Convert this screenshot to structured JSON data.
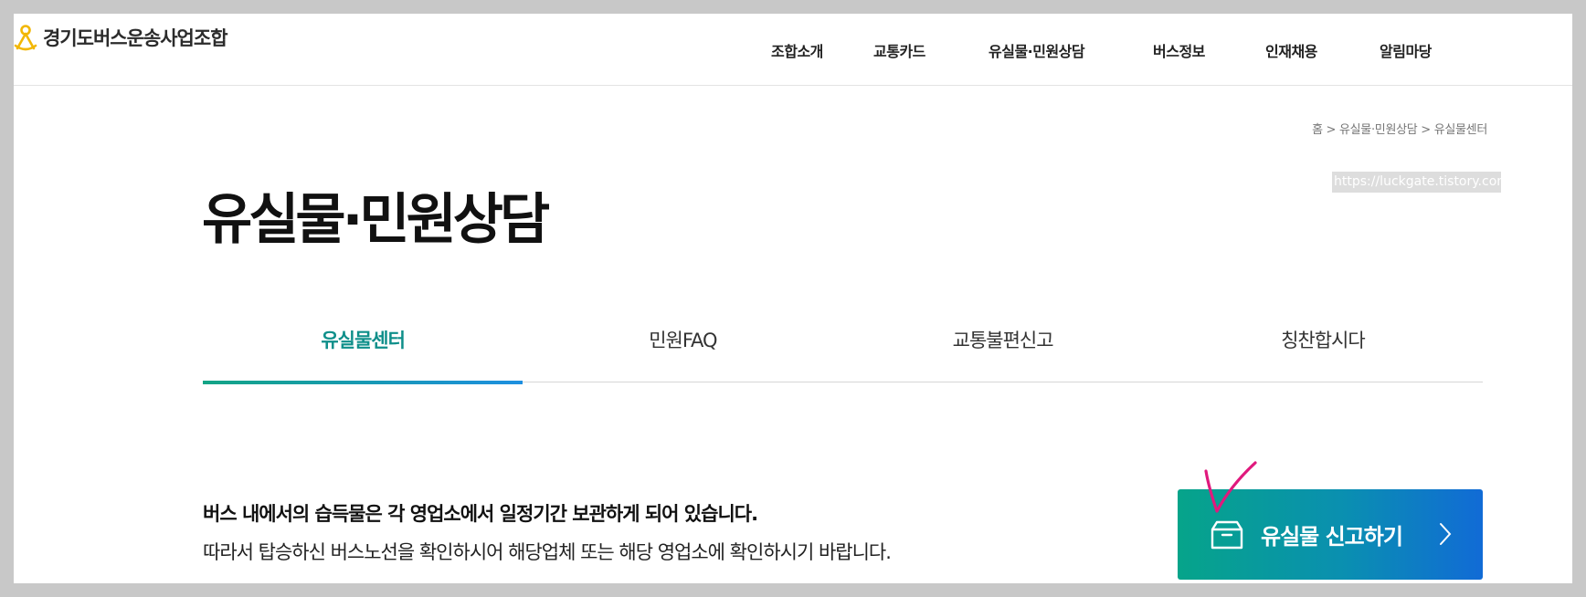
{
  "site": {
    "logo_text": "경기도버스운송사업조합"
  },
  "nav": {
    "items": [
      "조합소개",
      "교통카드",
      "유실물·민원상담",
      "버스정보",
      "인재채용",
      "알림마당"
    ]
  },
  "breadcrumb": "홈 > 유실물·민원상담 > 유실물센터",
  "watermark": "https://luckgate.tistory.com",
  "page_title": "유실물·민원상담",
  "tabs": [
    {
      "label": "유실물센터",
      "active": true
    },
    {
      "label": "민원FAQ",
      "active": false
    },
    {
      "label": "교통불편신고",
      "active": false
    },
    {
      "label": "칭찬합시다",
      "active": false
    }
  ],
  "notice": {
    "line1": "버스 내에서의 습득물은 각 영업소에서 일정기간 보관하게 되어 있습니다.",
    "line2": "따라서 탑승하신 버스노선을 확인하시어 해당업체 또는 해당 영업소에 확인하시기 바랍니다."
  },
  "report_button": {
    "label": "유실물 신고하기",
    "icon": "box-icon"
  },
  "colors": {
    "accent_teal": "#0f8f8a",
    "button_gradient_start": "#06a48a",
    "button_gradient_end": "#116bd6",
    "annotation_mark": "#e0197d",
    "logo": "#f2b705"
  }
}
